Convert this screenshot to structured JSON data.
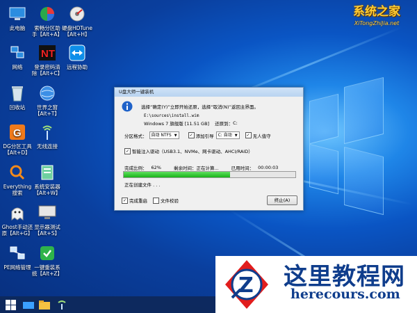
{
  "desktop_icons": [
    {
      "name": "此电脑",
      "icon": "this-pc-icon"
    },
    {
      "name": "网络",
      "icon": "network-icon"
    },
    {
      "name": "回收站",
      "icon": "recycle-bin-icon"
    },
    {
      "name": "DG分区工具\n【Alt+D】",
      "icon": "dg-partition-icon"
    },
    {
      "name": "Everything\n搜索",
      "icon": "everything-search-icon"
    },
    {
      "name": "Ghost手动还\n原【Alt+G】",
      "icon": "ghost-icon"
    },
    {
      "name": "PE网络管理",
      "icon": "pe-network-icon"
    },
    {
      "name": "索畅分区助\n手【Alt+A】",
      "icon": "partition-assistant-icon"
    },
    {
      "name": "登录密码清\n除【Alt+C】",
      "icon": "password-clear-icon"
    },
    {
      "name": "世界之窗\n【Alt+T】",
      "icon": "world-window-icon"
    },
    {
      "name": "无线连接",
      "icon": "wireless-icon"
    },
    {
      "name": "系统安装器\n【Alt+W】",
      "icon": "system-installer-icon"
    },
    {
      "name": "显示器测试\n【Alt+S】",
      "icon": "monitor-test-icon"
    },
    {
      "name": "一键重装系\n统【Alt+Z】",
      "icon": "one-key-reinstall-icon"
    },
    {
      "name": "硬盘HDTune\n【Alt+H】",
      "icon": "hdtune-icon"
    },
    {
      "name": "远程协助",
      "icon": "teamviewer-icon"
    }
  ],
  "watermark_top": {
    "line1": "系统之家",
    "line2": "XiTongZhiJia.net"
  },
  "dialog": {
    "title": "U盘大师一键装机",
    "message": "选择“确定(Y)”立即开始还原，选择“取消(N)”返回主界面。",
    "source_path": "E:\\sources\\install.wim",
    "image_info": "Windows 7 旗舰版 [11.51 GB]",
    "restore_to_label": "还原到：",
    "restore_to_value": "C:",
    "partition_format_label": "分区格式：",
    "partition_format_value": "自动 NTFS",
    "add_boot_label": "添加引导",
    "add_boot_value": "C: 自动",
    "add_boot_checked": true,
    "unattended_label": "无人值守",
    "unattended_checked": true,
    "smart_driver_label": "智能注入驱动（USB3.1、NVMe、网卡驱动、AHCI/RAID）",
    "smart_driver_checked": true,
    "progress_label": "完成比例：",
    "progress_value": "62%",
    "progress_fraction": 0.62,
    "remaining_label": "剩余时间：",
    "remaining_value": "正在计算...",
    "elapsed_label": "已用时间：",
    "elapsed_value": "00:00:03",
    "status_text": "正在创建文件 . . .",
    "restart_label": "完成重启",
    "restart_checked": true,
    "verify_label": "文件校验",
    "verify_checked": false,
    "stop_button": "终止(A)"
  },
  "taskbar": {
    "items": [
      "start-icon",
      "taskview-icon",
      "file-explorer-icon",
      "wireless-tray-icon"
    ]
  },
  "watermark_bottom": {
    "cn": "这里教程网",
    "url": "herecours.com"
  },
  "colors": {
    "accent": "#0a55c4",
    "progress": "#19b319",
    "watermark": "#0f3d8c"
  }
}
